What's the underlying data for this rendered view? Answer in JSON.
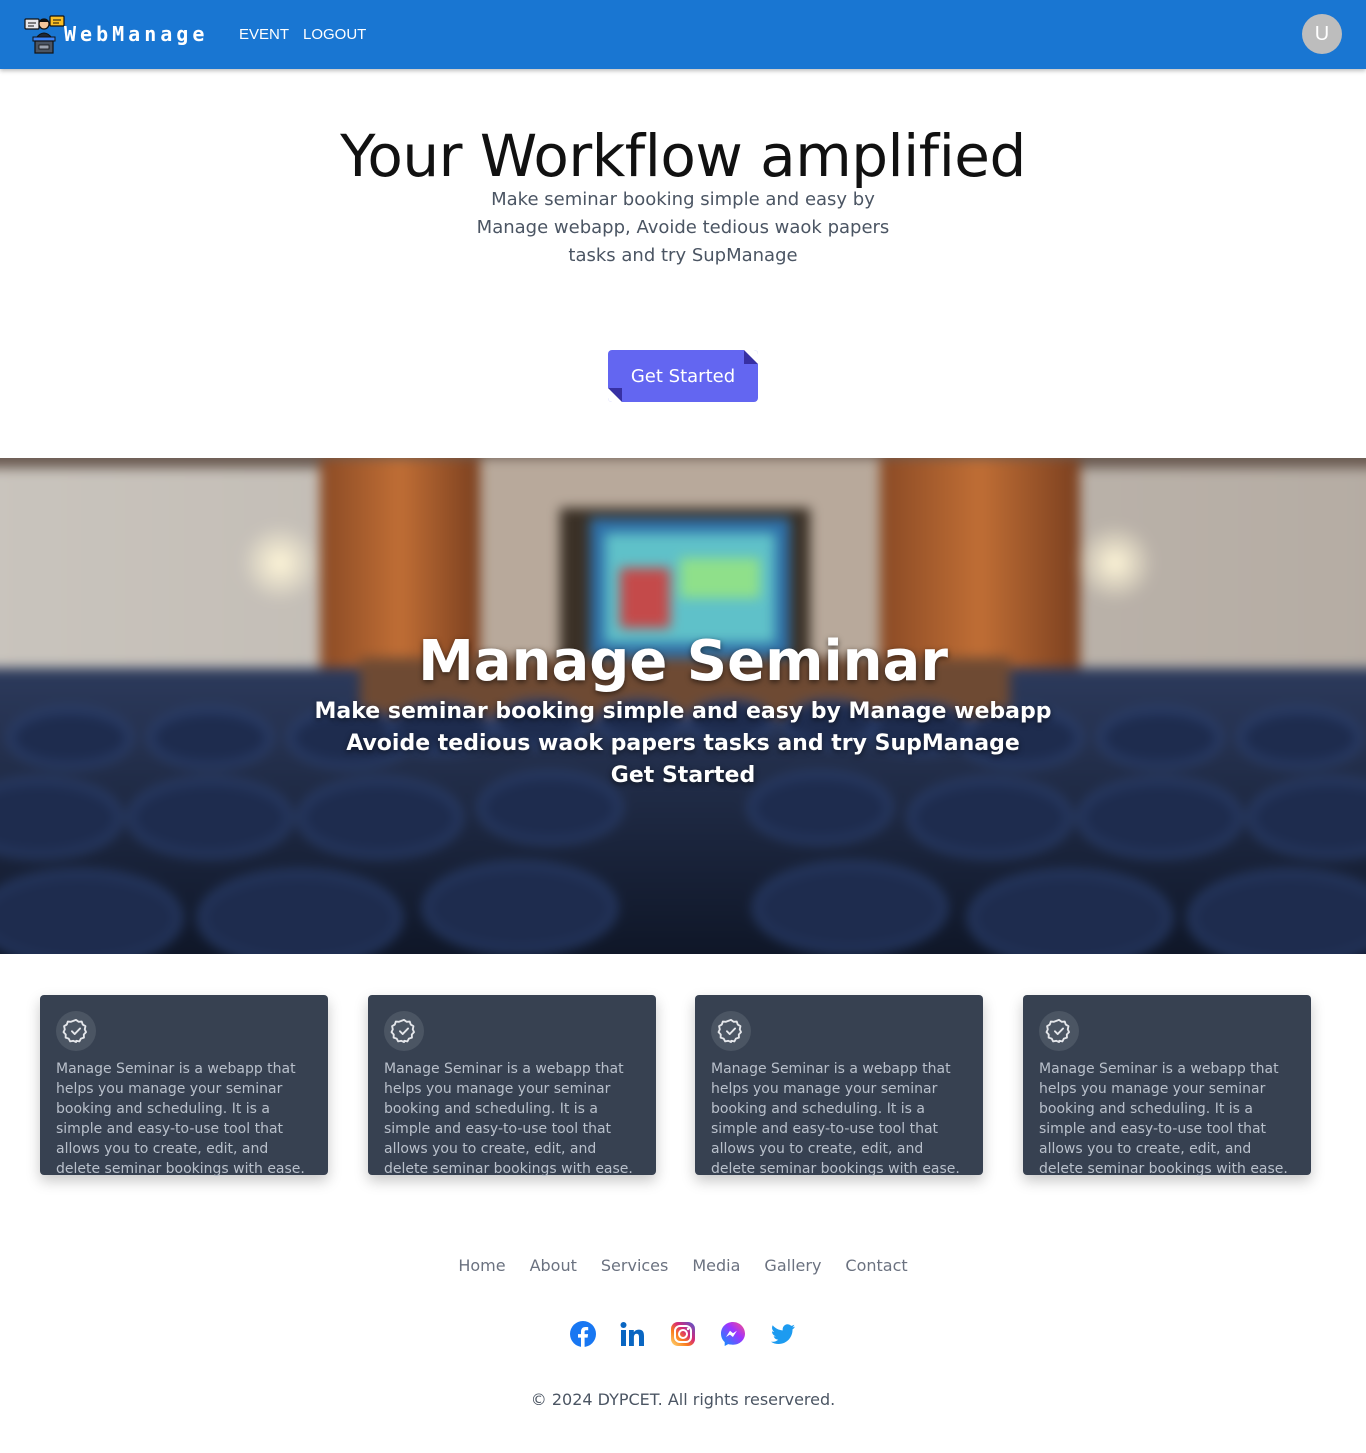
{
  "navbar": {
    "brand": "WebManage",
    "links": [
      "EVENT",
      "LOGOUT"
    ],
    "avatar_letter": "U",
    "bg_color": "#1976d2"
  },
  "hero": {
    "title": "Your Workflow amplified",
    "subtitle": "Make seminar booking simple and easy by Manage webapp, Avoide tedious waok papers tasks and try SupManage",
    "button_label": "Get Started",
    "button_color": "#6366f1"
  },
  "banner": {
    "title": "Manage Seminar",
    "line1": "Make seminar booking simple and easy by Manage webapp",
    "line2": "Avoide tedious waok papers tasks and try SupManage",
    "cta": "Get Started"
  },
  "cards": [
    {
      "icon": "verified-badge-icon",
      "text": "Manage Seminar is a webapp that helps you manage your seminar booking and scheduling. It is a simple and easy-to-use tool that allows you to create, edit, and delete seminar bookings with ease."
    },
    {
      "icon": "verified-badge-icon",
      "text": "Manage Seminar is a webapp that helps you manage your seminar booking and scheduling. It is a simple and easy-to-use tool that allows you to create, edit, and delete seminar bookings with ease."
    },
    {
      "icon": "verified-badge-icon",
      "text": "Manage Seminar is a webapp that helps you manage your seminar booking and scheduling. It is a simple and easy-to-use tool that allows you to create, edit, and delete seminar bookings with ease."
    },
    {
      "icon": "verified-badge-icon",
      "text": "Manage Seminar is a webapp that helps you manage your seminar booking and scheduling. It is a simple and easy-to-use tool that allows you to create, edit, and delete seminar bookings with ease."
    }
  ],
  "footer": {
    "links": [
      "Home",
      "About",
      "Services",
      "Media",
      "Gallery",
      "Contact"
    ],
    "socials": [
      "facebook-icon",
      "linkedin-icon",
      "instagram-icon",
      "messenger-icon",
      "twitter-icon"
    ],
    "copyright": "© 2024 DYPCET. All rights reservered."
  }
}
